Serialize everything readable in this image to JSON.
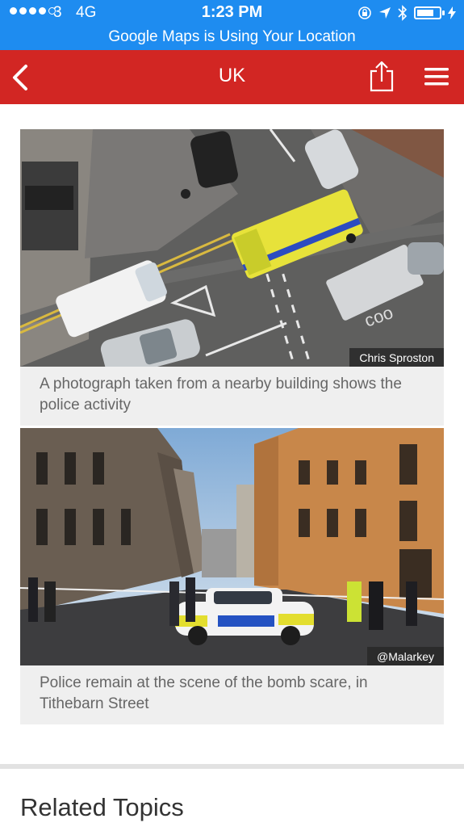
{
  "status": {
    "carrier": "3",
    "network": "4G",
    "time": "1:23 PM",
    "banner": "Google Maps is Using Your Location",
    "signal_bars": 4,
    "signal_max": 5
  },
  "nav": {
    "title": "UK",
    "back_icon": "chevron-left-icon",
    "share_icon": "share-icon",
    "menu_icon": "hamburger-menu-icon"
  },
  "figures": [
    {
      "credit": "Chris Sproston",
      "caption": "A photograph taken from a nearby building shows the police activity"
    },
    {
      "credit": "@Malarkey",
      "caption": "Police remain at the scene of the bomb scare, in Tithebarn Street"
    }
  ],
  "related": {
    "heading": "Related Topics"
  },
  "colors": {
    "status_bar": "#1e8cf0",
    "nav_bar": "#d22623",
    "caption_bg": "#efefef"
  }
}
